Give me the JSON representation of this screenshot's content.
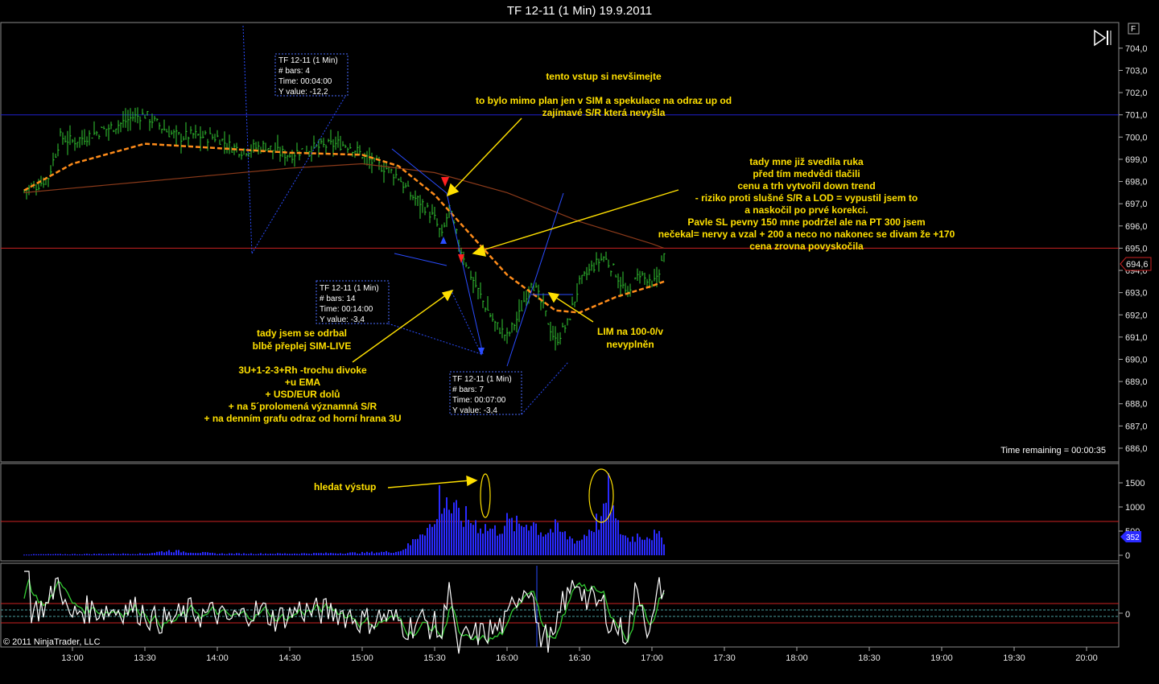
{
  "title": "TF 12-11 (1 Min)  19.9.2011",
  "footer": "© 2011 NinjaTrader, LLC",
  "time_remaining": "Time remaining = 00:00:35",
  "current_price_label": "694,6",
  "current_volume_label": "352",
  "f_button": "F",
  "colors": {
    "background": "#000000",
    "price_bars": "#33cc33",
    "ema": "#ff8c1a",
    "slow_ma": "#8b3a1a",
    "support_line": "#cc2222",
    "resistance_line": "#2020cc",
    "volume": "#2a2aff",
    "annotation": "#ffe000",
    "osc_white": "#ffffff",
    "osc_green": "#33cc33"
  },
  "chart_data": [
    {
      "type": "line",
      "name": "price",
      "x_ticks": [
        "13:00",
        "13:30",
        "14:00",
        "14:30",
        "15:00",
        "15:30",
        "16:00",
        "16:30",
        "17:00",
        "17:30",
        "18:00",
        "18:30",
        "19:00",
        "19:30",
        "20:00"
      ],
      "y_ticks": [
        "704,0",
        "703,0",
        "702,0",
        "701,0",
        "700,0",
        "699,0",
        "698,0",
        "697,0",
        "696,0",
        "695,0",
        "694,0",
        "693,0",
        "692,0",
        "691,0",
        "690,0",
        "689,0",
        "688,0",
        "687,0",
        "686,0"
      ],
      "ylim": [
        685.6,
        704.9
      ],
      "horizontal_lines": [
        701.0,
        695.0
      ],
      "close_series": [
        [
          "12:40",
          697.6
        ],
        [
          "12:45",
          697.8
        ],
        [
          "12:50",
          698.2
        ],
        [
          "12:55",
          700.0
        ],
        [
          "13:00",
          699.8
        ],
        [
          "13:05",
          700.0
        ],
        [
          "13:10",
          700.2
        ],
        [
          "13:15",
          700.4
        ],
        [
          "13:20",
          700.6
        ],
        [
          "13:25",
          700.9
        ],
        [
          "13:30",
          701.0
        ],
        [
          "13:35",
          700.6
        ],
        [
          "13:40",
          700.2
        ],
        [
          "13:45",
          700.0
        ],
        [
          "13:50",
          700.1
        ],
        [
          "13:55",
          700.0
        ],
        [
          "14:00",
          700.0
        ],
        [
          "14:05",
          699.6
        ],
        [
          "14:10",
          699.4
        ],
        [
          "14:15",
          699.5
        ],
        [
          "14:20",
          699.6
        ],
        [
          "14:25",
          699.3
        ],
        [
          "14:30",
          699.2
        ],
        [
          "14:35",
          699.4
        ],
        [
          "14:40",
          699.5
        ],
        [
          "14:45",
          699.6
        ],
        [
          "14:50",
          699.7
        ],
        [
          "14:55",
          699.6
        ],
        [
          "15:00",
          699.2
        ],
        [
          "15:05",
          698.8
        ],
        [
          "15:10",
          698.6
        ],
        [
          "15:15",
          698.2
        ],
        [
          "15:20",
          697.4
        ],
        [
          "15:25",
          697.0
        ],
        [
          "15:30",
          696.3
        ],
        [
          "15:33",
          695.5
        ],
        [
          "15:36",
          696.8
        ],
        [
          "15:40",
          695.2
        ],
        [
          "15:45",
          693.8
        ],
        [
          "15:50",
          692.6
        ],
        [
          "15:55",
          691.6
        ],
        [
          "16:00",
          691.0
        ],
        [
          "16:05",
          692.0
        ],
        [
          "16:10",
          693.6
        ],
        [
          "16:15",
          692.3
        ],
        [
          "16:20",
          690.8
        ],
        [
          "16:25",
          691.6
        ],
        [
          "16:30",
          693.4
        ],
        [
          "16:35",
          694.1
        ],
        [
          "16:40",
          694.6
        ],
        [
          "16:45",
          693.9
        ],
        [
          "16:50",
          692.8
        ],
        [
          "16:55",
          693.9
        ],
        [
          "17:00",
          693.2
        ],
        [
          "17:05",
          694.6
        ]
      ],
      "ema_series": [
        [
          "12:40",
          697.6
        ],
        [
          "13:00",
          698.8
        ],
        [
          "13:30",
          699.7
        ],
        [
          "14:00",
          699.5
        ],
        [
          "14:30",
          699.3
        ],
        [
          "15:00",
          699.2
        ],
        [
          "15:15",
          698.7
        ],
        [
          "15:30",
          697.4
        ],
        [
          "15:40",
          696.2
        ],
        [
          "15:45",
          695.6
        ],
        [
          "16:00",
          693.8
        ],
        [
          "16:10",
          693.0
        ],
        [
          "16:20",
          692.2
        ],
        [
          "16:30",
          692.1
        ],
        [
          "16:45",
          692.8
        ],
        [
          "17:00",
          693.3
        ],
        [
          "17:05",
          693.5
        ]
      ],
      "slow_ma_series": [
        [
          "12:40",
          697.5
        ],
        [
          "13:00",
          697.7
        ],
        [
          "13:30",
          698.0
        ],
        [
          "14:00",
          698.3
        ],
        [
          "14:30",
          698.6
        ],
        [
          "15:00",
          698.8
        ],
        [
          "15:30",
          698.4
        ],
        [
          "16:00",
          697.5
        ],
        [
          "16:30",
          696.2
        ],
        [
          "17:00",
          695.2
        ],
        [
          "17:05",
          695.0
        ]
      ]
    },
    {
      "type": "bar",
      "name": "volume",
      "y_ticks": [
        "1500",
        "1000",
        "500",
        "0"
      ],
      "ylim": [
        0,
        1800
      ],
      "reference_line": 700,
      "series": [
        [
          "12:40",
          20
        ],
        [
          "13:00",
          25
        ],
        [
          "13:30",
          40
        ],
        [
          "13:40",
          110
        ],
        [
          "14:00",
          40
        ],
        [
          "14:30",
          40
        ],
        [
          "15:00",
          60
        ],
        [
          "15:15",
          90
        ],
        [
          "15:20",
          260
        ],
        [
          "15:25",
          650
        ],
        [
          "15:30",
          700
        ],
        [
          "15:32",
          1450
        ],
        [
          "15:35",
          1200
        ],
        [
          "15:40",
          950
        ],
        [
          "15:45",
          850
        ],
        [
          "15:50",
          700
        ],
        [
          "15:55",
          600
        ],
        [
          "16:00",
          800
        ],
        [
          "16:05",
          700
        ],
        [
          "16:10",
          850
        ],
        [
          "16:15",
          550
        ],
        [
          "16:20",
          650
        ],
        [
          "16:25",
          450
        ],
        [
          "16:30",
          350
        ],
        [
          "16:35",
          700
        ],
        [
          "16:40",
          950
        ],
        [
          "16:42",
          1700
        ],
        [
          "16:45",
          750
        ],
        [
          "16:50",
          400
        ],
        [
          "16:55",
          500
        ],
        [
          "17:00",
          500
        ],
        [
          "17:05",
          400
        ]
      ]
    },
    {
      "type": "line",
      "name": "oscillator",
      "y_ticks": [
        "0"
      ],
      "ylim": [
        -1,
        1
      ],
      "bands": [
        0.3,
        0.1,
        -0.1,
        -0.3
      ]
    }
  ],
  "annotations": {
    "tip1": [
      "TF 12-11 (1 Min)",
      "# bars:   4",
      "Time:     00:04:00",
      "Y value:  -12,2"
    ],
    "tip2": [
      "TF 12-11 (1 Min)",
      "# bars:   14",
      "Time:     00:14:00",
      "Y value:  -3,4"
    ],
    "tip3": [
      "TF 12-11 (1 Min)",
      "# bars:   7",
      "Time:     00:07:00",
      "Y value:  -3,4"
    ],
    "note_top": [
      "tento vstup si nevšimejte",
      "",
      "to bylo mimo plan jen v SIM a spekulace na odraz up od",
      "zajímavé S/R která nevyšla"
    ],
    "note_right": [
      "tady mne již svedila ruka",
      "před tím medvědi tlačili",
      "cenu a trh vytvořil down trend",
      "- riziko proti slušné S/R a LOD = vypustil jsem to",
      "a naskočil po prvé korekci.",
      "Pavle SL pevny 150 mne podržel ale na PT 300 jsem",
      "nečekal= nervy a vzal + 200 a neco no nakonec se divam že +170",
      "cena zrovna povyskočila"
    ],
    "note_left1": [
      "tady jsem se odrbal",
      "blbě přeplej SIM-LIVE"
    ],
    "note_left2": [
      "3U+1-2-3+Rh -trochu divoke",
      "+u EMA",
      "+ USD/EUR dolů",
      "+ na 5´prolomená významná S/R",
      "+ na denním grafu odraz od horní hrana 3U"
    ],
    "note_lim": [
      "LIM na 100-0/v",
      "nevyplněn"
    ],
    "note_volume": "hledat výstup"
  }
}
